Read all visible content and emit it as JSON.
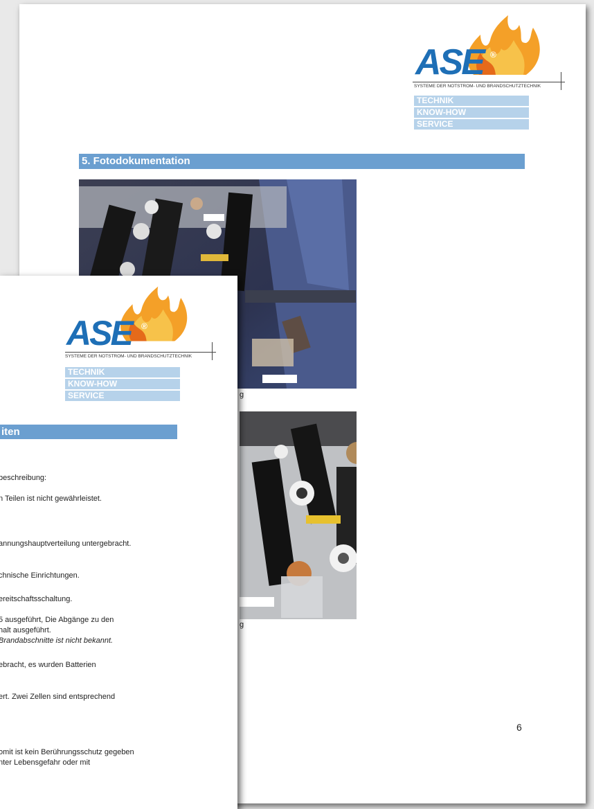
{
  "back_page": {
    "logo": {
      "brand": "ASE",
      "registered": "®",
      "tagline": "SYSTEME DER NOTSTROM- UND BRANDSCHUTZTECHNIK",
      "bars": [
        "TECHNIK",
        "KNOW-HOW",
        "SERVICE"
      ]
    },
    "section_title": "5. Fotodokumentation",
    "caption_1": "g",
    "caption_2": "g",
    "page_number": "6"
  },
  "front_page": {
    "logo": {
      "brand": "ASE",
      "registered": "®",
      "tagline": "SYSTEME DER NOTSTROM- UND BRANDSCHUTZTECHNIK",
      "bars": [
        "TECHNIK",
        "KNOW-HOW",
        "SERVICE"
      ]
    },
    "section_title": "iten",
    "lines": [
      "beschreibung:",
      "n Teilen ist nicht gewährleistet.",
      "annungshauptverteilung untergebracht.",
      "chnische Einrichtungen.",
      "ereitschaftsschaltung.",
      "5 ausgeführt, Die Abgänge zu den",
      "halt ausgeführt.",
      "Brandabschnitte ist  nicht bekannt.",
      "ebracht, es wurden Batterien",
      "ert. Zwei Zellen sind entsprechend",
      "omit ist kein Berührungsschutz gegeben",
      "nter Lebensgefahr oder mit"
    ]
  },
  "colors": {
    "brand_blue": "#1e6fb6",
    "section_bar": "#6b9fd0",
    "logo_bar": "#b6d2ea",
    "flame": "#f08a1c"
  }
}
